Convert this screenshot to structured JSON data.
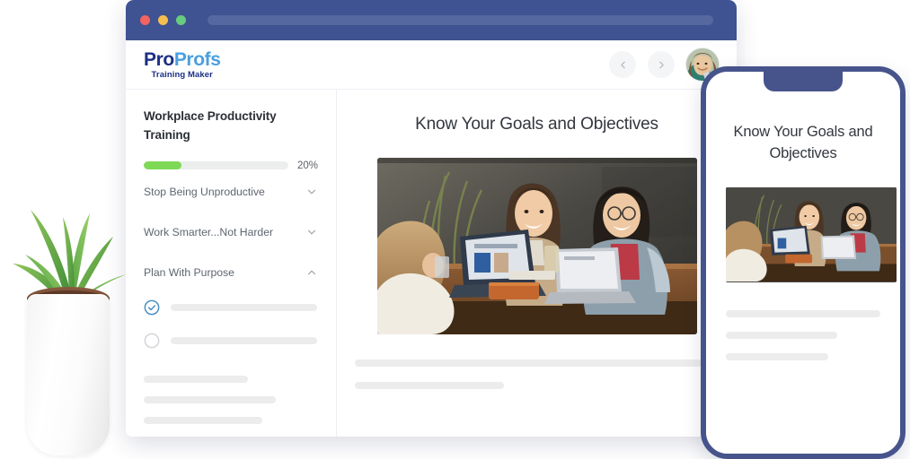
{
  "browser": {
    "traffic_lights": [
      "close-red",
      "minimize-yellow",
      "maximize-green"
    ],
    "colors": {
      "titlebar": "#3f5291",
      "urlbar": "#5668a0",
      "red": "#f1645f",
      "yellow": "#f5bf4f",
      "green": "#67cc7f"
    }
  },
  "app": {
    "logo": {
      "part1": "Pro",
      "part2": "Profs",
      "subtitle": "Training Maker",
      "color_part1": "#1b2f85",
      "color_part2": "#4a9fe0"
    },
    "header": {
      "prev_icon": "chevron-left-icon",
      "next_icon": "chevron-right-icon",
      "avatar_alt": "user-avatar"
    }
  },
  "sidebar": {
    "course_title": "Workplace Productivity Training",
    "progress": {
      "percent_label": "20%",
      "percent_value": 20,
      "fill_width": "26%",
      "fill_color": "#7ed957",
      "track_color": "#eceded"
    },
    "modules": [
      {
        "label": "Stop Being Unproductive",
        "icon": "chevron-down-icon",
        "expanded": false
      },
      {
        "label": "Work Smarter...Not Harder",
        "icon": "chevron-down-icon",
        "expanded": false
      },
      {
        "label": "Plan With Purpose",
        "icon": "chevron-up-icon",
        "expanded": true
      }
    ],
    "tasks": [
      {
        "state": "completed",
        "icon": "check-circle-icon",
        "bar_width": "84%"
      },
      {
        "state": "incomplete",
        "icon": "empty-circle-icon",
        "bar_width": "84%"
      }
    ],
    "placeholder_lines": [
      "60%",
      "76%",
      "68%"
    ]
  },
  "content": {
    "title": "Know Your Goals and Objectives",
    "image_alt": "three-people-laughing-with-laptops-at-wooden-table",
    "placeholder_lines": [
      "100%",
      "41%"
    ]
  },
  "phone": {
    "title": "Know Your Goals and Objectives",
    "image_alt": "three-people-laughing-with-laptops-at-wooden-table",
    "placeholder_lines": [
      "100%",
      "72%",
      "66%"
    ],
    "frame_color": "#47548c"
  },
  "decor": {
    "plant_alt": "potted-aloe-plant"
  }
}
